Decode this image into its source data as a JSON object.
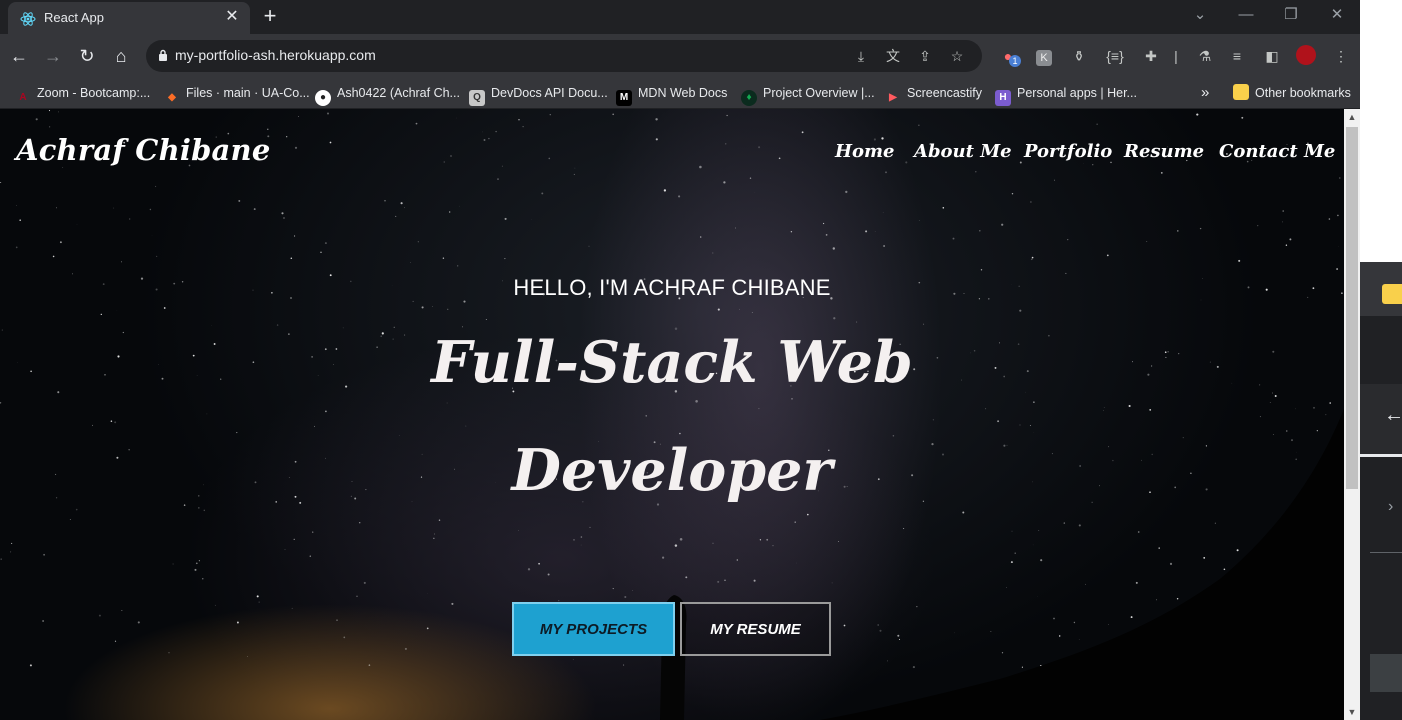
{
  "browser": {
    "tab": {
      "title": "React App",
      "close_label": "✕"
    },
    "new_tab_label": "+",
    "url": "my-portfolio-ash.herokuapp.com",
    "extension_badge": "1",
    "bookmarks": [
      {
        "label": "Zoom - Bootcamp:...",
        "icon": "arizona-icon",
        "color": "#ab0520"
      },
      {
        "label": "Files · main · UA-Co...",
        "icon": "gitlab-icon",
        "color": "#fc6d26"
      },
      {
        "label": "Ash0422 (Achraf Ch...",
        "icon": "github-icon",
        "color": "#ffffff"
      },
      {
        "label": "DevDocs API Docu...",
        "icon": "devdocs-icon",
        "color": "#9aa0a6"
      },
      {
        "label": "MDN Web Docs",
        "icon": "mdn-icon",
        "color": "#000000"
      },
      {
        "label": "Project Overview |...",
        "icon": "mongodb-icon",
        "color": "#13aa52"
      },
      {
        "label": "Screencastify",
        "icon": "screencastify-icon",
        "color": "#ff5a5f"
      },
      {
        "label": "Personal apps | Her...",
        "icon": "heroku-icon",
        "color": "#7b5ccf"
      }
    ],
    "bookmarks_overflow": "»",
    "other_bookmarks": "Other bookmarks"
  },
  "site": {
    "brand": "Achraf Chibane",
    "nav": [
      "Home",
      "About Me",
      "Portfolio",
      "Resume",
      "Contact Me"
    ],
    "hero": {
      "greeting": "HELLO, I'M ACHRAF CHIBANE",
      "title_line1": "Full-Stack Web",
      "title_line2": "Developer",
      "primary_button": "MY PROJECTS",
      "secondary_button": "MY RESUME"
    }
  },
  "colors": {
    "primary_button": "#1ea1d0",
    "tabbar": "#202124",
    "toolbar": "#35363a"
  }
}
